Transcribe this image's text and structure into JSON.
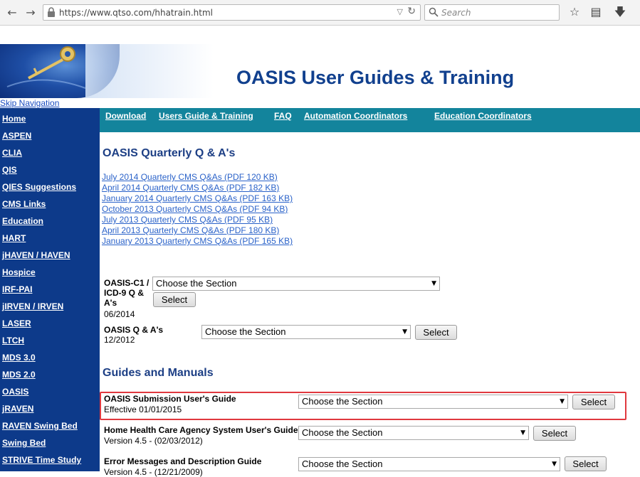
{
  "browser": {
    "back_icon": "back-arrow-icon",
    "forward_icon": "forward-arrow-icon",
    "url": "https://www.qtso.com/hhatrain.html",
    "search_placeholder": "Search",
    "icons": [
      "star-icon",
      "reading-list-icon",
      "download-icon"
    ]
  },
  "header": {
    "title": "OASIS User Guides & Training",
    "skip_nav": "Skip Navigation"
  },
  "sidebar": {
    "items": [
      "Home",
      "ASPEN",
      "CLIA",
      "QIS",
      "QIES Suggestions",
      "CMS Links",
      "Education",
      "HART",
      "jHAVEN / HAVEN",
      "Hospice",
      "IRF-PAI",
      "jIRVEN / IRVEN",
      "LASER",
      "LTCH",
      "MDS 3.0",
      "MDS 2.0",
      "OASIS",
      "jRAVEN",
      "RAVEN Swing Bed",
      "Swing Bed",
      "STRIVE Time Study"
    ]
  },
  "topnav": {
    "items": [
      "Download",
      "Users Guide & Training",
      "FAQ",
      "Automation Coordinators",
      "Education Coordinators"
    ]
  },
  "qa_section": {
    "heading": "OASIS Quarterly Q & A's",
    "links": [
      "July 2014 Quarterly CMS Q&As (PDF 120 KB)",
      "April 2014 Quarterly CMS Q&As (PDF 182 KB)",
      "January 2014 Quarterly CMS Q&As (PDF 163 KB)",
      "October 2013 Quarterly CMS Q&As (PDF 94 KB)",
      "July 2013 Quarterly CMS Q&As (PDF 95 KB)",
      "April 2013 Quarterly CMS Q&As (PDF 180 KB)",
      "January 2013 Quarterly CMS Q&As (PDF 165 KB)"
    ]
  },
  "qa_forms": [
    {
      "label": "OASIS-C1 / ICD-9 Q & A's",
      "sub": "06/2014",
      "select": "Choose the Section",
      "button": "Select"
    },
    {
      "label": "OASIS Q & A's",
      "sub": "12/2012",
      "select": "Choose the Section",
      "button": "Select"
    }
  ],
  "guides_section": {
    "heading": "Guides and Manuals",
    "rows": [
      {
        "label": "OASIS Submission User's Guide",
        "sub": "Effective 01/01/2015",
        "select": "Choose the Section",
        "button": "Select"
      },
      {
        "label": "Home Health Care Agency System User's Guide",
        "sub": "Version 4.5 - (02/03/2012)",
        "select": "Choose the Section",
        "button": "Select"
      },
      {
        "label": "Error Messages and Description Guide",
        "sub": "Version 4.5 - (12/21/2009)",
        "select": "Choose the Section",
        "button": "Select"
      }
    ]
  },
  "colors": {
    "sidebar_bg": "#0d3a8a",
    "topnav_bg": "#13849c",
    "title_color": "#11408e",
    "link_color": "#2a62c9",
    "highlight_border": "#e0383e"
  }
}
